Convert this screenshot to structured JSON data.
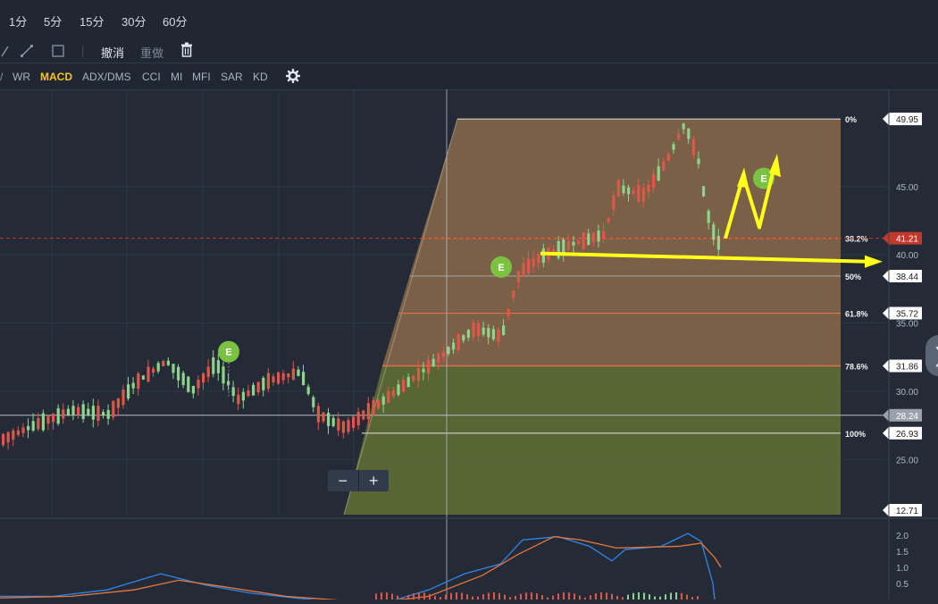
{
  "toolbar": {
    "timeframes": [
      "1分",
      "5分",
      "15分",
      "30分",
      "60分"
    ],
    "draw_tools": {
      "line_icon": "diagonal-line-icon",
      "rect_icon": "rectangle-icon",
      "undo": "撤消",
      "redo": "重做",
      "delete_icon": "trash-icon"
    },
    "indicators": [
      "WR",
      "MACD",
      "ADX/DMS",
      "CCI",
      "MI",
      "MFI",
      "SAR",
      "KD"
    ],
    "active_indicator": "MACD",
    "settings_icon": "gear-icon"
  },
  "zoom": {
    "minus": "−",
    "plus": "+"
  },
  "side_handle": {
    "icon": "chevron-right-icon",
    "glyph": "❯"
  },
  "chart_data": {
    "type": "candlestick",
    "price_axis": {
      "ticks": [
        "45.00",
        "40.00",
        "35.00",
        "30.00",
        "25.00"
      ],
      "ylim": [
        20.96,
        52.12
      ]
    },
    "price_tags": [
      {
        "label": "49.95",
        "value": 49.95,
        "kind": "fib"
      },
      {
        "label": "41.21",
        "value": 41.21,
        "kind": "current"
      },
      {
        "label": "38.44",
        "value": 38.44,
        "kind": "fib"
      },
      {
        "label": "35.72",
        "value": 35.72,
        "kind": "fib"
      },
      {
        "label": "31.86",
        "value": 31.86,
        "kind": "fib"
      },
      {
        "label": "28.24",
        "value": 28.24,
        "kind": "crosshair"
      },
      {
        "label": "26.93",
        "value": 26.93,
        "kind": "fib"
      },
      {
        "label": "12.71",
        "value": 12.71,
        "kind": "bottom"
      }
    ],
    "fibonacci": [
      {
        "label": "0%",
        "value": 49.95
      },
      {
        "label": "38.2%",
        "value": 41.21
      },
      {
        "label": "50%",
        "value": 38.44
      },
      {
        "label": "61.8%",
        "value": 35.72
      },
      {
        "label": "78.6%",
        "value": 31.86
      },
      {
        "label": "100%",
        "value": 26.93
      }
    ],
    "event_markers": [
      {
        "label": "E",
        "value": 32.9
      },
      {
        "label": "E",
        "value": 39.1
      },
      {
        "label": "E",
        "value": 45.6
      }
    ],
    "macd_axis": {
      "ticks": [
        "2.0",
        "1.5",
        "1.0",
        "0.5"
      ],
      "ylim": [
        0.0,
        2.3
      ]
    },
    "colors": {
      "up": "#e0574a",
      "down": "#8fd48c",
      "fib_zone": "#8a6a4a",
      "fib_lower": "#5e6b35",
      "current": "#c0392b",
      "arrow": "#ffff1a",
      "marker": "#7cc242",
      "macd_line": "#2f86eb",
      "signal_line": "#e8753a"
    }
  }
}
